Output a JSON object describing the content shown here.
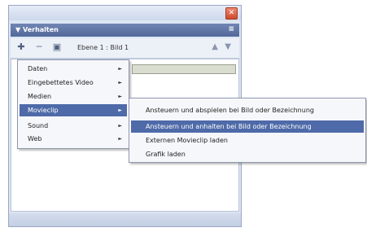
{
  "window": {
    "close_glyph": "✕"
  },
  "panel": {
    "title": "▼ Verhalten",
    "options_glyph": "≡"
  },
  "toolbar": {
    "icons": [
      "add-behavior-icon",
      "remove-behavior-icon",
      "object-icon"
    ],
    "target_label": "Ebene 1 : Bild 1",
    "arrows": [
      "▲",
      "▼"
    ]
  },
  "menu": {
    "items": [
      {
        "label": "Daten"
      },
      {
        "label": "Eingebettetes Video"
      },
      {
        "label": "Medien"
      },
      {
        "label": "Movieclip",
        "selected": true
      },
      {
        "label": "Sound"
      },
      {
        "label": "Web"
      }
    ],
    "arrow_glyph": "►"
  },
  "submenu": {
    "items": [
      {
        "label": "Ansteuern und abspielen bei Bild oder Bezeichnung"
      },
      {
        "label": "Ansteuern und anhalten bei Bild oder Bezeichnung",
        "selected": true
      },
      {
        "label": "Externen Movieclip laden"
      },
      {
        "label": "Grafik laden"
      }
    ]
  },
  "colors": {
    "selection": "#4e6aa8",
    "panel_header": "#5d719f",
    "window_bg": "#dde5f2"
  }
}
